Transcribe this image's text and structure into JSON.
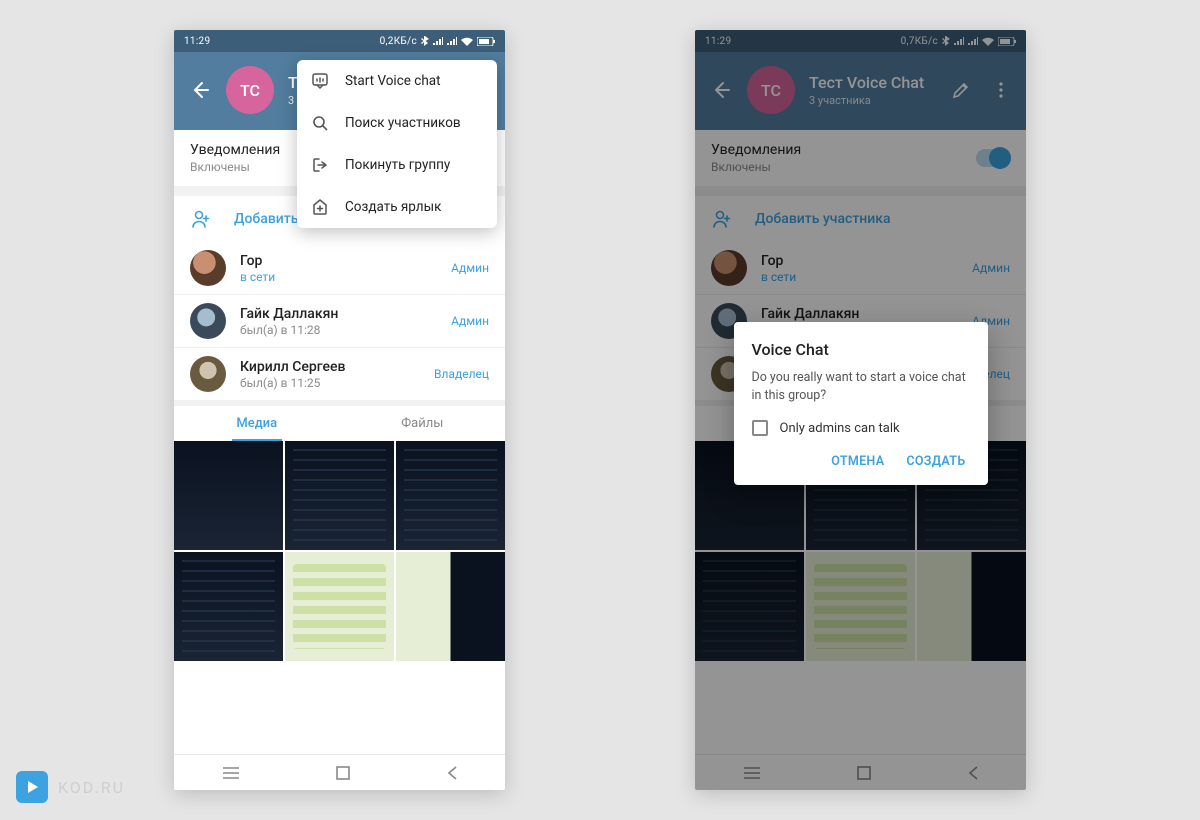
{
  "statusbar": {
    "time": "11:29",
    "net_left": "0,2КБ/с",
    "net_right": "0,7КБ/с"
  },
  "header": {
    "avatar_initials": "TC",
    "title": "Тест Voice Chat",
    "subtitle": "3 участника"
  },
  "notifications": {
    "title": "Уведомления",
    "value": "Включены"
  },
  "add_member_label": "Добавить участника",
  "members": [
    {
      "name": "Гор",
      "status": "в сети",
      "status_online": true,
      "role": "Админ"
    },
    {
      "name": "Гайк Даллакян",
      "status": "был(а) в 11:28",
      "status_online": false,
      "role": "Админ"
    },
    {
      "name": "Кирилл Сергеев",
      "status": "был(а) в 11:25",
      "status_online": false,
      "role": "Владелец"
    }
  ],
  "tabs": {
    "media": "Медиа",
    "files": "Файлы"
  },
  "menu": {
    "start_voice": "Start Voice chat",
    "search": "Поиск участников",
    "leave": "Покинуть группу",
    "shortcut": "Создать ярлык"
  },
  "dialog": {
    "title": "Voice Chat",
    "body": "Do you really want to start a voice chat in this group?",
    "checkbox": "Only admins can talk",
    "cancel": "ОТМЕНА",
    "create": "СОЗДАТЬ"
  },
  "watermark": "KOD.RU"
}
